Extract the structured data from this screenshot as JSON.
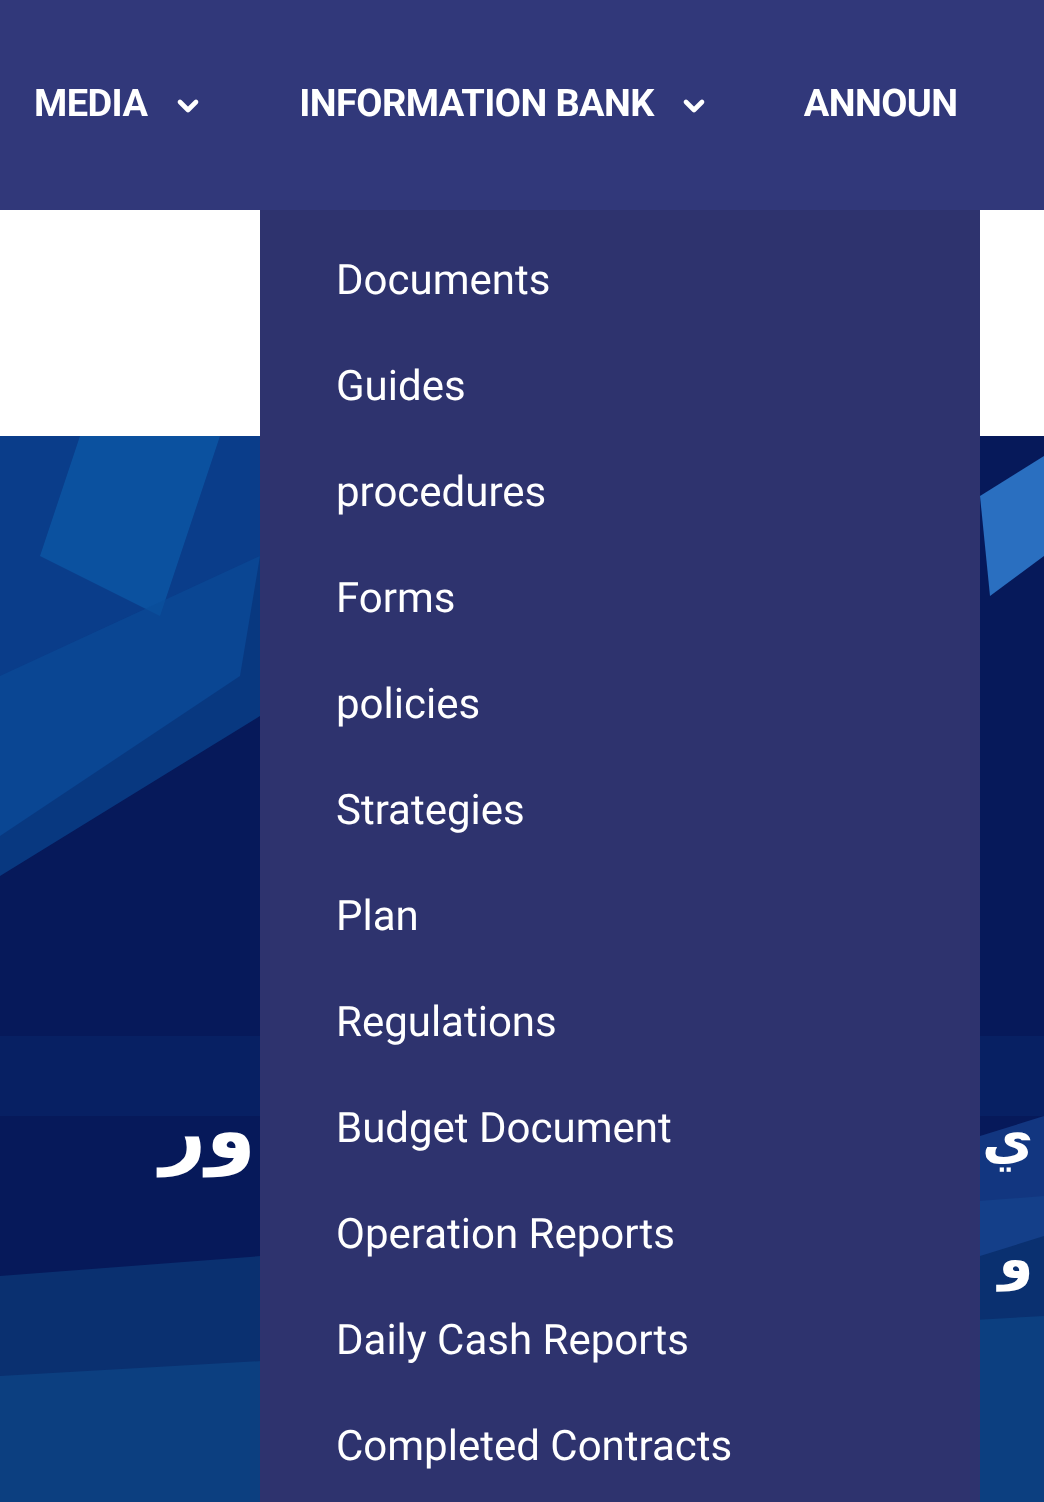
{
  "nav": {
    "items": [
      {
        "label": "MEDIA",
        "has_dropdown": true
      },
      {
        "label": "INFORMATION BANK",
        "has_dropdown": true,
        "menu": [
          "Documents",
          "Guides",
          "procedures",
          "Forms",
          "policies",
          "Strategies",
          "Plan",
          "Regulations",
          "Budget Document",
          "Operation Reports",
          "Daily Cash Reports",
          "Completed Contracts"
        ]
      },
      {
        "label": "ANNOUN",
        "has_dropdown": false
      }
    ]
  },
  "hero": {
    "left_text": "ور",
    "right_lines": [
      "ي",
      "و"
    ]
  }
}
